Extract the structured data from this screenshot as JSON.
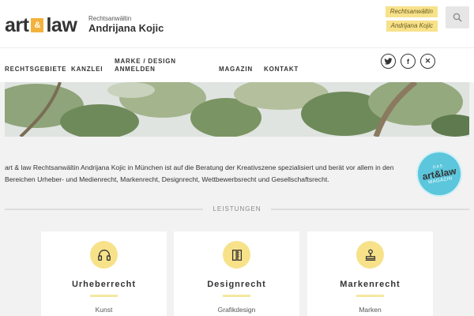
{
  "brand": {
    "word1": "art",
    "amp": "&",
    "word2": "law",
    "subtitle": "Rechtsanwältin",
    "name": "Andrijana Kojic"
  },
  "header_tags": [
    "Rechtsanwältin",
    "Andrijana Kojic"
  ],
  "search": {
    "icon": "search-icon"
  },
  "nav": {
    "items": [
      "RECHTSGEBIETE",
      "KANZLEI",
      "MARKE / DESIGN ANMELDEN",
      "MAGAZIN",
      "KONTAKT"
    ]
  },
  "social": [
    {
      "icon": "twitter-icon",
      "glyph": "🐦"
    },
    {
      "icon": "facebook-icon",
      "glyph": "f"
    },
    {
      "icon": "xing-icon",
      "glyph": "✕"
    }
  ],
  "intro": "art & law Rechtsanwältin Andrijana Kojic in München ist auf die Beratung der Kreativszene spezialisiert und berät vor allem in den Bereichen Urheber- und Medienrecht, Markenrecht, Designrecht, Wettbewerbsrecht und Gesellschaftsrecht.",
  "magazine_badge": {
    "top": "DAS",
    "mid": "art&law",
    "bottom": "MAGAZIN"
  },
  "section_title": "LEISTUNGEN",
  "cards": [
    {
      "title": "Urheberrecht",
      "sub": "Kunst",
      "icon": "headphones-icon"
    },
    {
      "title": "Designrecht",
      "sub": "Grafikdesign",
      "icon": "pencil-ruler-icon"
    },
    {
      "title": "Markenrecht",
      "sub": "Marken",
      "icon": "stamp-icon"
    }
  ],
  "colors": {
    "accent_yellow": "#f7e28a",
    "badge_blue": "#5bc6dc",
    "logo_orange": "#f3b23c"
  }
}
